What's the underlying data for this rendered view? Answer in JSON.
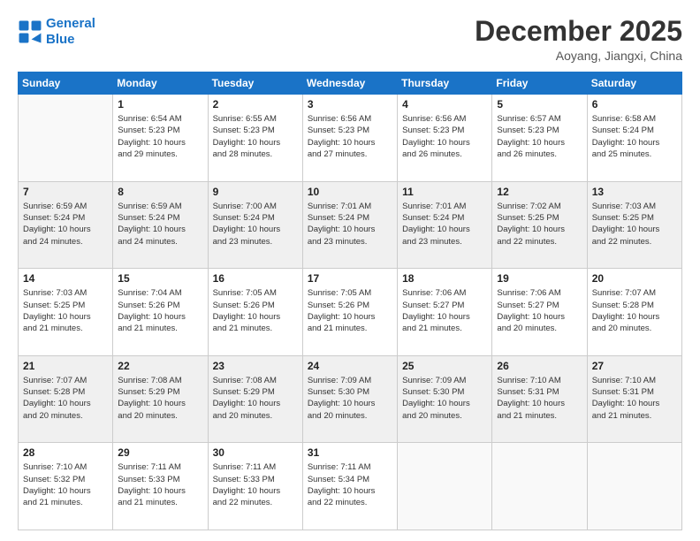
{
  "logo": {
    "line1": "General",
    "line2": "Blue"
  },
  "title": "December 2025",
  "location": "Aoyang, Jiangxi, China",
  "weekdays": [
    "Sunday",
    "Monday",
    "Tuesday",
    "Wednesday",
    "Thursday",
    "Friday",
    "Saturday"
  ],
  "weeks": [
    [
      {
        "day": "",
        "info": ""
      },
      {
        "day": "1",
        "info": "Sunrise: 6:54 AM\nSunset: 5:23 PM\nDaylight: 10 hours\nand 29 minutes."
      },
      {
        "day": "2",
        "info": "Sunrise: 6:55 AM\nSunset: 5:23 PM\nDaylight: 10 hours\nand 28 minutes."
      },
      {
        "day": "3",
        "info": "Sunrise: 6:56 AM\nSunset: 5:23 PM\nDaylight: 10 hours\nand 27 minutes."
      },
      {
        "day": "4",
        "info": "Sunrise: 6:56 AM\nSunset: 5:23 PM\nDaylight: 10 hours\nand 26 minutes."
      },
      {
        "day": "5",
        "info": "Sunrise: 6:57 AM\nSunset: 5:23 PM\nDaylight: 10 hours\nand 26 minutes."
      },
      {
        "day": "6",
        "info": "Sunrise: 6:58 AM\nSunset: 5:24 PM\nDaylight: 10 hours\nand 25 minutes."
      }
    ],
    [
      {
        "day": "7",
        "info": "Sunrise: 6:59 AM\nSunset: 5:24 PM\nDaylight: 10 hours\nand 24 minutes."
      },
      {
        "day": "8",
        "info": "Sunrise: 6:59 AM\nSunset: 5:24 PM\nDaylight: 10 hours\nand 24 minutes."
      },
      {
        "day": "9",
        "info": "Sunrise: 7:00 AM\nSunset: 5:24 PM\nDaylight: 10 hours\nand 23 minutes."
      },
      {
        "day": "10",
        "info": "Sunrise: 7:01 AM\nSunset: 5:24 PM\nDaylight: 10 hours\nand 23 minutes."
      },
      {
        "day": "11",
        "info": "Sunrise: 7:01 AM\nSunset: 5:24 PM\nDaylight: 10 hours\nand 23 minutes."
      },
      {
        "day": "12",
        "info": "Sunrise: 7:02 AM\nSunset: 5:25 PM\nDaylight: 10 hours\nand 22 minutes."
      },
      {
        "day": "13",
        "info": "Sunrise: 7:03 AM\nSunset: 5:25 PM\nDaylight: 10 hours\nand 22 minutes."
      }
    ],
    [
      {
        "day": "14",
        "info": "Sunrise: 7:03 AM\nSunset: 5:25 PM\nDaylight: 10 hours\nand 21 minutes."
      },
      {
        "day": "15",
        "info": "Sunrise: 7:04 AM\nSunset: 5:26 PM\nDaylight: 10 hours\nand 21 minutes."
      },
      {
        "day": "16",
        "info": "Sunrise: 7:05 AM\nSunset: 5:26 PM\nDaylight: 10 hours\nand 21 minutes."
      },
      {
        "day": "17",
        "info": "Sunrise: 7:05 AM\nSunset: 5:26 PM\nDaylight: 10 hours\nand 21 minutes."
      },
      {
        "day": "18",
        "info": "Sunrise: 7:06 AM\nSunset: 5:27 PM\nDaylight: 10 hours\nand 21 minutes."
      },
      {
        "day": "19",
        "info": "Sunrise: 7:06 AM\nSunset: 5:27 PM\nDaylight: 10 hours\nand 20 minutes."
      },
      {
        "day": "20",
        "info": "Sunrise: 7:07 AM\nSunset: 5:28 PM\nDaylight: 10 hours\nand 20 minutes."
      }
    ],
    [
      {
        "day": "21",
        "info": "Sunrise: 7:07 AM\nSunset: 5:28 PM\nDaylight: 10 hours\nand 20 minutes."
      },
      {
        "day": "22",
        "info": "Sunrise: 7:08 AM\nSunset: 5:29 PM\nDaylight: 10 hours\nand 20 minutes."
      },
      {
        "day": "23",
        "info": "Sunrise: 7:08 AM\nSunset: 5:29 PM\nDaylight: 10 hours\nand 20 minutes."
      },
      {
        "day": "24",
        "info": "Sunrise: 7:09 AM\nSunset: 5:30 PM\nDaylight: 10 hours\nand 20 minutes."
      },
      {
        "day": "25",
        "info": "Sunrise: 7:09 AM\nSunset: 5:30 PM\nDaylight: 10 hours\nand 20 minutes."
      },
      {
        "day": "26",
        "info": "Sunrise: 7:10 AM\nSunset: 5:31 PM\nDaylight: 10 hours\nand 21 minutes."
      },
      {
        "day": "27",
        "info": "Sunrise: 7:10 AM\nSunset: 5:31 PM\nDaylight: 10 hours\nand 21 minutes."
      }
    ],
    [
      {
        "day": "28",
        "info": "Sunrise: 7:10 AM\nSunset: 5:32 PM\nDaylight: 10 hours\nand 21 minutes."
      },
      {
        "day": "29",
        "info": "Sunrise: 7:11 AM\nSunset: 5:33 PM\nDaylight: 10 hours\nand 21 minutes."
      },
      {
        "day": "30",
        "info": "Sunrise: 7:11 AM\nSunset: 5:33 PM\nDaylight: 10 hours\nand 22 minutes."
      },
      {
        "day": "31",
        "info": "Sunrise: 7:11 AM\nSunset: 5:34 PM\nDaylight: 10 hours\nand 22 minutes."
      },
      {
        "day": "",
        "info": ""
      },
      {
        "day": "",
        "info": ""
      },
      {
        "day": "",
        "info": ""
      }
    ]
  ]
}
